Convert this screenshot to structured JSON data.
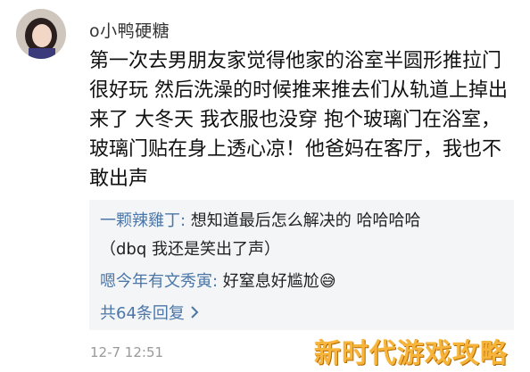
{
  "post": {
    "username": "o小鸭硬糖",
    "lines": [
      "第一次去男朋友家觉得他家的浴室半圆形推拉门",
      "很好玩 然后洗澡的时候推来推去们从轨道上掉出",
      "来了 大冬天 我衣服也没穿 抱个玻璃门在浴室，",
      "玻璃门贴在身上透心凉！他爸妈在客厅，我也不",
      "敢出声"
    ],
    "timestamp": "12-7 12:51"
  },
  "replies": [
    {
      "author": "一颗辣雞丁:",
      "text": " 想知道最后怎么解决的 哈哈哈哈",
      "text2": "（dbq 我还是笑出了声）"
    },
    {
      "author": "嗯今年有文秀寅:",
      "text": " 好窒息好尴尬",
      "emoji": "😅"
    }
  ],
  "more_replies_label": "共64条回复",
  "more_icon": "chevron-right-icon",
  "watermark": "新时代游戏攻略",
  "colors": {
    "link": "#4a76a8",
    "watermark": "#f6b43a",
    "reply_bg": "#f4f5f7"
  }
}
